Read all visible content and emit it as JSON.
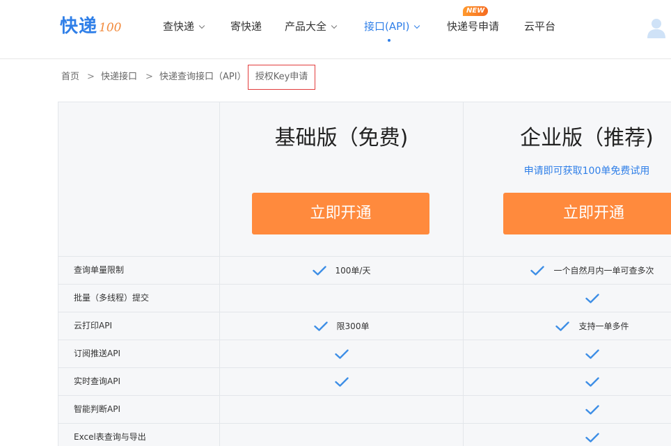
{
  "header": {
    "logo_main": "快递",
    "logo_sub": "100",
    "nav": [
      {
        "label": "查快递",
        "dropdown": true
      },
      {
        "label": "寄快递",
        "dropdown": false
      },
      {
        "label": "产品大全",
        "dropdown": true
      },
      {
        "label": "接口(API)",
        "dropdown": true,
        "active": true
      },
      {
        "label": "快递号申请",
        "dropdown": false,
        "badge": "NEW"
      },
      {
        "label": "云平台",
        "dropdown": false
      }
    ],
    "user_icon": "user-avatar-icon"
  },
  "breadcrumb": {
    "items": [
      "首页",
      "快递接口",
      "快递查询接口（API）"
    ],
    "separator": ">",
    "current": "授权Key申请"
  },
  "plans": [
    {
      "title": "基础版（免费)",
      "subtitle": "",
      "button": "立即开通"
    },
    {
      "title": "企业版（推荐)",
      "subtitle": "申请即可获取100单免费试用",
      "button": "立即开通"
    }
  ],
  "features": [
    {
      "name": "查询单量限制",
      "basic": {
        "check": true,
        "text": "100单/天"
      },
      "enterprise": {
        "check": true,
        "text": "一个自然月内一单可查多次"
      }
    },
    {
      "name": "批量（多线程）提交",
      "basic": {
        "check": false,
        "text": ""
      },
      "enterprise": {
        "check": true,
        "text": ""
      }
    },
    {
      "name": "云打印API",
      "basic": {
        "check": true,
        "text": "限300单"
      },
      "enterprise": {
        "check": true,
        "text": "支持一单多件"
      }
    },
    {
      "name": "订阅推送API",
      "basic": {
        "check": true,
        "text": ""
      },
      "enterprise": {
        "check": true,
        "text": ""
      }
    },
    {
      "name": "实时查询API",
      "basic": {
        "check": true,
        "text": ""
      },
      "enterprise": {
        "check": true,
        "text": ""
      }
    },
    {
      "name": "智能判断API",
      "basic": {
        "check": false,
        "text": ""
      },
      "enterprise": {
        "check": true,
        "text": ""
      }
    },
    {
      "name": "Excel表查询与导出",
      "basic": {
        "check": false,
        "text": ""
      },
      "enterprise": {
        "check": true,
        "text": ""
      }
    }
  ],
  "colors": {
    "brand_blue": "#2f7fe8",
    "brand_orange": "#ff8a3d",
    "breadcrumb_highlight": "#e23b3b"
  }
}
